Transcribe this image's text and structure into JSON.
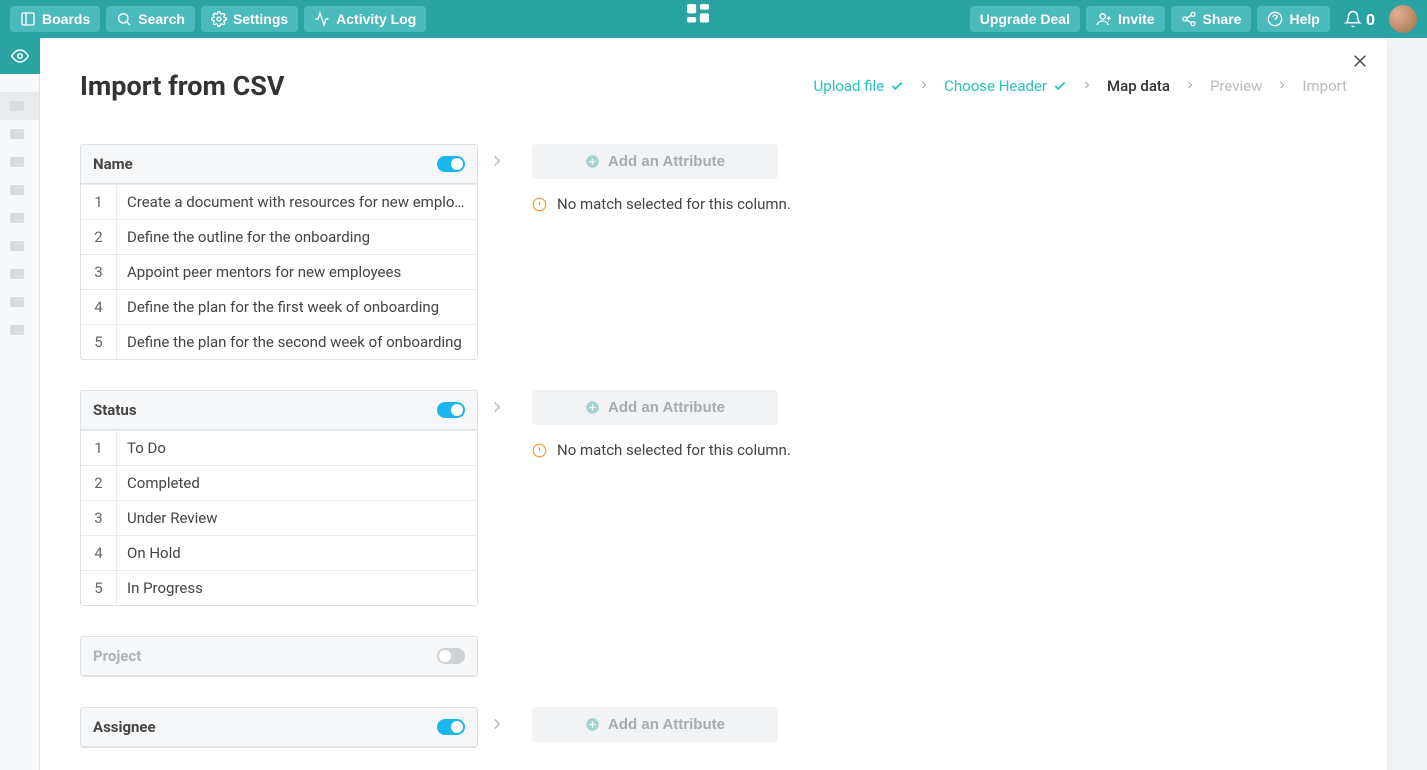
{
  "topbar": {
    "boards": "Boards",
    "search": "Search",
    "settings": "Settings",
    "activity": "Activity Log",
    "upgrade": "Upgrade Deal",
    "invite": "Invite",
    "share": "Share",
    "help": "Help",
    "notif_count": "0"
  },
  "modal": {
    "title": "Import from CSV",
    "steps": {
      "upload": "Upload file",
      "choose": "Choose Header",
      "map": "Map data",
      "preview": "Preview",
      "import": "Import"
    },
    "add_attr": "Add an Attribute",
    "no_match": "No match selected for this column."
  },
  "columns": {
    "name": {
      "header": "Name",
      "rows": [
        "Create a document with resources for new employees",
        "Define the outline for the onboarding",
        "Appoint peer mentors for new employees",
        "Define the plan for the first week of onboarding",
        "Define the plan for the second week of onboarding"
      ]
    },
    "status": {
      "header": "Status",
      "rows": [
        "To Do",
        "Completed",
        "Under Review",
        "On Hold",
        "In Progress"
      ]
    },
    "project": {
      "header": "Project"
    },
    "assignee": {
      "header": "Assignee"
    }
  }
}
